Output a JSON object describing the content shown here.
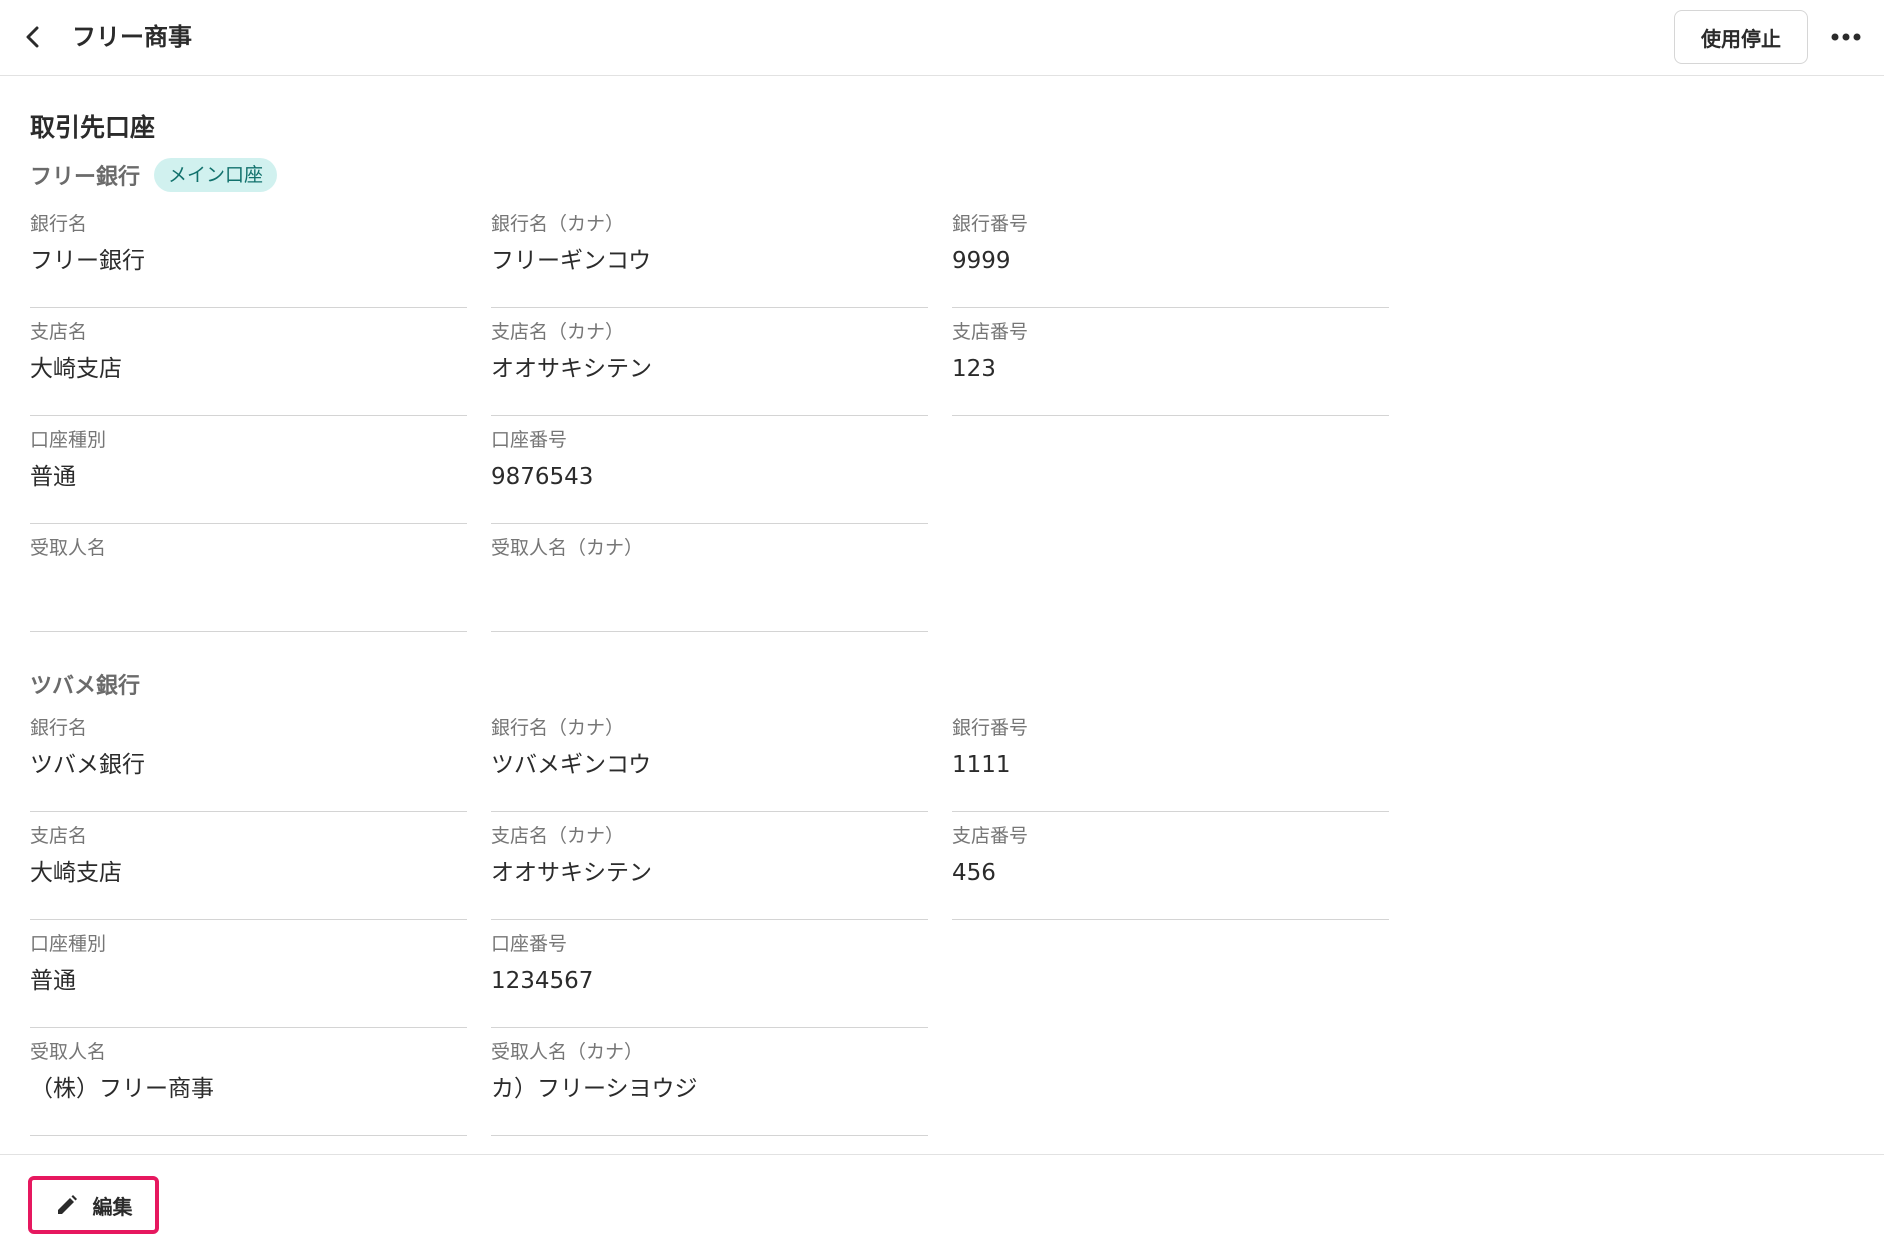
{
  "header": {
    "title": "フリー商事",
    "suspend_label": "使用停止",
    "back_icon": "chevron-left-icon",
    "more_icon": "more-horizontal-icon"
  },
  "section": {
    "title": "取引先口座"
  },
  "accounts": [
    {
      "bank_heading": "フリー銀行",
      "badge": "メイン口座",
      "fields": {
        "bank_name": {
          "label": "銀行名",
          "value": "フリー銀行"
        },
        "bank_name_kana": {
          "label": "銀行名（カナ）",
          "value": "フリーギンコウ"
        },
        "bank_code": {
          "label": "銀行番号",
          "value": "9999"
        },
        "branch_name": {
          "label": "支店名",
          "value": "大崎支店"
        },
        "branch_name_kana": {
          "label": "支店名（カナ）",
          "value": "オオサキシテン"
        },
        "branch_code": {
          "label": "支店番号",
          "value": "123"
        },
        "account_type": {
          "label": "口座種別",
          "value": "普通"
        },
        "account_number": {
          "label": "口座番号",
          "value": "9876543"
        },
        "recipient_name": {
          "label": "受取人名",
          "value": ""
        },
        "recipient_name_kana": {
          "label": "受取人名（カナ）",
          "value": ""
        }
      }
    },
    {
      "bank_heading": "ツバメ銀行",
      "fields": {
        "bank_name": {
          "label": "銀行名",
          "value": "ツバメ銀行"
        },
        "bank_name_kana": {
          "label": "銀行名（カナ）",
          "value": "ツバメギンコウ"
        },
        "bank_code": {
          "label": "銀行番号",
          "value": "1111"
        },
        "branch_name": {
          "label": "支店名",
          "value": "大崎支店"
        },
        "branch_name_kana": {
          "label": "支店名（カナ）",
          "value": "オオサキシテン"
        },
        "branch_code": {
          "label": "支店番号",
          "value": "456"
        },
        "account_type": {
          "label": "口座種別",
          "value": "普通"
        },
        "account_number": {
          "label": "口座番号",
          "value": "1234567"
        },
        "recipient_name": {
          "label": "受取人名",
          "value": "（株）フリー商事"
        },
        "recipient_name_kana": {
          "label": "受取人名（カナ）",
          "value": "カ）フリーシヨウジ"
        }
      }
    }
  ],
  "footer": {
    "edit_label": "編集",
    "edit_icon": "pencil-icon",
    "highlight_color": "#e6185f"
  },
  "colors": {
    "badge_bg": "#d1f1ef",
    "badge_text": "#11716c"
  }
}
